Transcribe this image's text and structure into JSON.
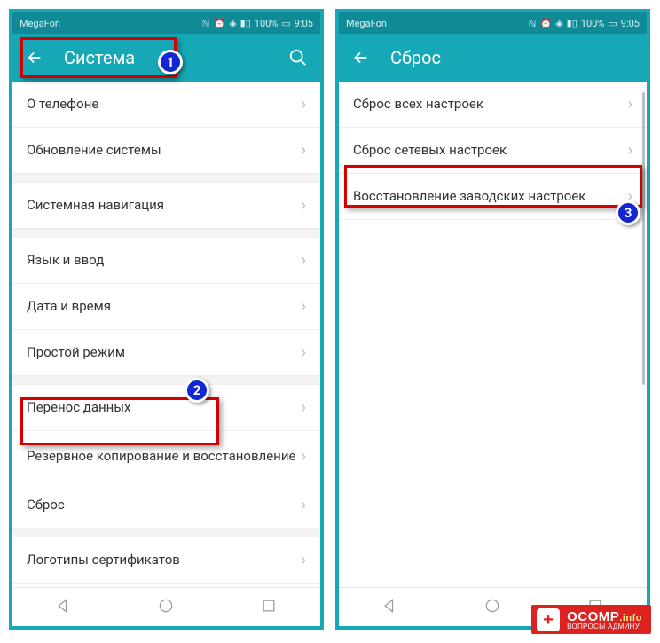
{
  "status": {
    "carrier": "MegaFon",
    "battery": "100%",
    "time": "9:05"
  },
  "left": {
    "title": "Система",
    "items": [
      "О телефоне",
      "Обновление системы",
      "Системная навигация",
      "Язык и ввод",
      "Дата и время",
      "Простой режим",
      "Перенос данных",
      "Резервное копирование и восстановление",
      "Сброс",
      "Логотипы сертификатов"
    ]
  },
  "right": {
    "title": "Сброс",
    "items": [
      "Сброс всех настроек",
      "Сброс сетевых настроек",
      "Восстановление заводских настроек"
    ]
  },
  "steps": {
    "s1": "1",
    "s2": "2",
    "s3": "3"
  },
  "watermark": {
    "main": "OCOMP",
    "suffix": ".info",
    "sub": "ВОПРОСЫ АДМИНУ"
  }
}
